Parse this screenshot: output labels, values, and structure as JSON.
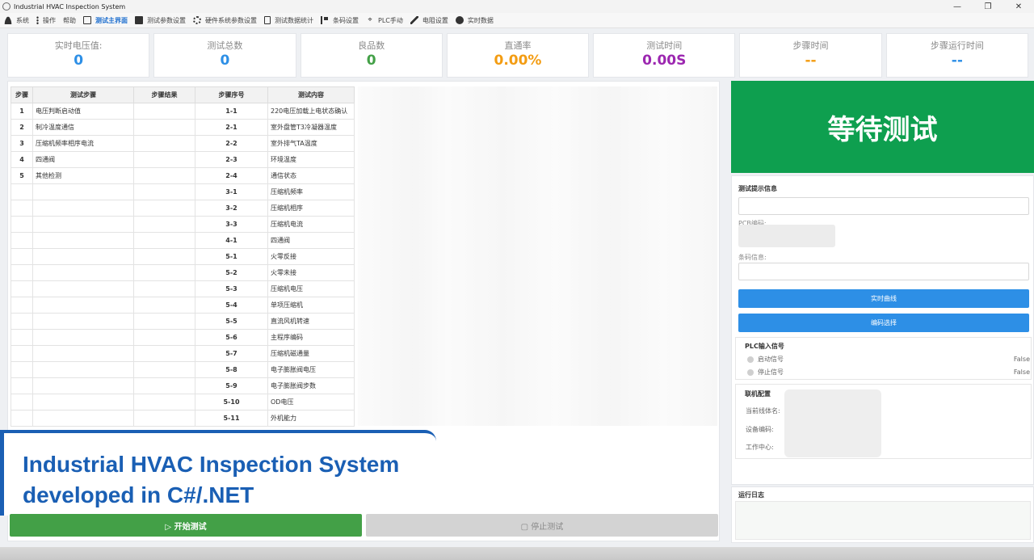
{
  "window": {
    "title": "Industrial HVAC Inspection System",
    "minimize": "—",
    "maximize": "❐",
    "close": "✕"
  },
  "menu": [
    {
      "label": "系统",
      "icon": "user-icon"
    },
    {
      "label": "操作",
      "icon": "more-vertical-icon"
    },
    {
      "label": "帮助",
      "icon": "help-icon"
    },
    {
      "label": "测试主界面",
      "icon": "monitor-icon",
      "active": true
    },
    {
      "label": "测试参数设置",
      "icon": "settings-box-icon"
    },
    {
      "label": "硬件系统参数设置",
      "icon": "gear-icon"
    },
    {
      "label": "测试数据统计",
      "icon": "document-icon"
    },
    {
      "label": "条码设置",
      "icon": "flag-icon"
    },
    {
      "label": "PLC手动",
      "icon": "plc-icon"
    },
    {
      "label": "电阻设置",
      "icon": "pen-icon"
    },
    {
      "label": "实时数据",
      "icon": "clock-icon"
    }
  ],
  "stats": [
    {
      "label": "实时电压值:",
      "value": "0",
      "color": "#2d8fe6"
    },
    {
      "label": "测试总数",
      "value": "0",
      "color": "#2d8fe6"
    },
    {
      "label": "良品数",
      "value": "0",
      "color": "#43a047"
    },
    {
      "label": "直通率",
      "value": "0.00%",
      "color": "#f39c12"
    },
    {
      "label": "测试时间",
      "value": "0.00S",
      "color": "#9c27b0"
    },
    {
      "label": "步骤时间",
      "value": "--",
      "color": "#f39c12"
    },
    {
      "label": "步骤运行时间",
      "value": "--",
      "color": "#2d8fe6"
    }
  ],
  "table": {
    "headers": [
      "步骤",
      "测试步骤",
      "步骤结果",
      "步骤序号",
      "测试内容"
    ],
    "rows": [
      [
        "1",
        "电压判断启动值",
        "",
        "1-1",
        "220电压加载上电状态确认"
      ],
      [
        "2",
        "制冷温度通信",
        "",
        "2-1",
        "室外盘管T3冷凝器温度"
      ],
      [
        "3",
        "压缩机频率相序电流",
        "",
        "2-2",
        "室外排气TA温度"
      ],
      [
        "4",
        "四通阀",
        "",
        "2-3",
        "环境温度"
      ],
      [
        "5",
        "其他检测",
        "",
        "2-4",
        "通信状态"
      ],
      [
        "",
        "",
        "",
        "3-1",
        "压缩机频率"
      ],
      [
        "",
        "",
        "",
        "3-2",
        "压缩机相序"
      ],
      [
        "",
        "",
        "",
        "3-3",
        "压缩机电流"
      ],
      [
        "",
        "",
        "",
        "4-1",
        "四通阀"
      ],
      [
        "",
        "",
        "",
        "5-1",
        "火零反接"
      ],
      [
        "",
        "",
        "",
        "5-2",
        "火零未接"
      ],
      [
        "",
        "",
        "",
        "5-3",
        "压缩机电压"
      ],
      [
        "",
        "",
        "",
        "5-4",
        "单项压缩机"
      ],
      [
        "",
        "",
        "",
        "5-5",
        "直流风机转速"
      ],
      [
        "",
        "",
        "",
        "5-6",
        "主程序编码"
      ],
      [
        "",
        "",
        "",
        "5-7",
        "压缩机磁通量"
      ],
      [
        "",
        "",
        "",
        "5-8",
        "电子膨胀阀电压"
      ],
      [
        "",
        "",
        "",
        "5-9",
        "电子膨胀阀步数"
      ],
      [
        "",
        "",
        "",
        "5-10",
        "OD电压"
      ],
      [
        "",
        "",
        "",
        "5-11",
        "外机能力"
      ]
    ]
  },
  "overlay": {
    "line1": "Industrial HVAC Inspection System",
    "line2": "developed in C#/.NET"
  },
  "buttons": {
    "start": "▷ 开始测试",
    "stop": "▢ 停止测试"
  },
  "status": {
    "text": "等待测试"
  },
  "right": {
    "hint_title": "测试提示信息",
    "pcb_label": "PCB编码:",
    "barcode_label": "条码信息:",
    "realtime_curve": "实时曲线",
    "code_select": "编码选择",
    "plc_title": "PLC输入信号",
    "plc_signals": [
      {
        "label": "启动信号",
        "value": "False"
      },
      {
        "label": "停止信号",
        "value": "False"
      }
    ],
    "link_title": "联机配置",
    "link_fields": [
      "当前线体名:",
      "设备编码:",
      "工作中心:"
    ],
    "log_title": "运行日志"
  }
}
